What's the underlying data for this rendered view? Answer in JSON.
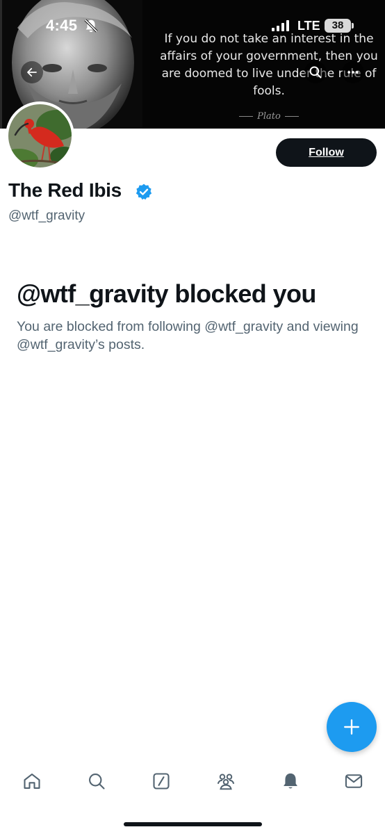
{
  "status_bar": {
    "time": "4:45",
    "network": "LTE",
    "battery": "38"
  },
  "banner": {
    "quote": "If you do not take an interest in the affairs of your government, then you are doomed to live under the rule of fools.",
    "author": "Plato"
  },
  "profile": {
    "display_name": "The Red Ibis",
    "handle": "@wtf_gravity",
    "follow_label": "Follow",
    "verified_color": "#1d9bf0"
  },
  "blocked": {
    "title": "@wtf_gravity blocked you",
    "description": "You are blocked from following @wtf_gravity and viewing @wtf_gravity’s posts."
  },
  "nav": {
    "items": [
      "home-icon",
      "search-icon",
      "grok-icon",
      "communities-icon",
      "notifications-icon",
      "messages-icon"
    ]
  },
  "colors": {
    "accent": "#1d9bf0",
    "text_primary": "#0f1419",
    "text_secondary": "#536471"
  }
}
